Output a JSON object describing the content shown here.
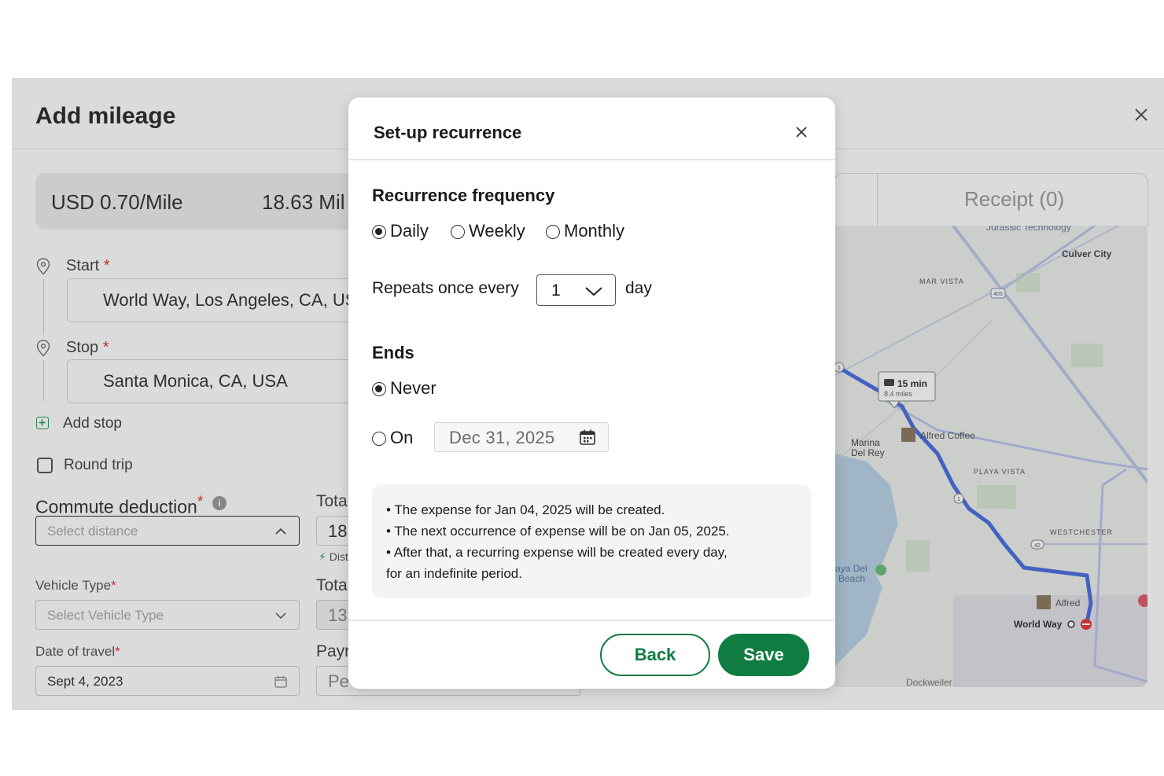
{
  "background": {
    "title": "Add mileage",
    "rate": "USD 0.70/Mile",
    "miles": "18.63 Mil",
    "tab_receipt": "Receipt (0)",
    "start_label": "Start",
    "start_value": "World Way, Los Angeles, CA, USA",
    "stop_label": "Stop",
    "stop_value": "Santa Monica, CA, USA",
    "required_mark": "*",
    "add_stop": "Add stop",
    "round_trip": "Round trip",
    "commute_label": "Commute deduction",
    "commute_placeholder": "Select distance",
    "vehicle_label": "Vehicle Type",
    "vehicle_placeholder": "Select Vehicle Type",
    "date_label": "Date of travel",
    "date_value": "Sept 4, 2023",
    "right_label_1": "Tota",
    "right_value_1": "18",
    "dist_note": "Dist",
    "right_label_2": "Tota",
    "right_value_2": "13",
    "right_label_3": "Payr",
    "right_value_3": "Pe"
  },
  "map": {
    "labels": {
      "jurassic": "Jurassic Technology",
      "culver": "Culver City",
      "mar_vista": "MAR VISTA",
      "marina1": "Marina",
      "marina2": "Del Rey",
      "alfred1": "Alfred Coffee",
      "playa": "PLAYA VISTA",
      "westchester": "WESTCHESTER",
      "playa_beach1": "aya Del",
      "playa_beach2": "Beach",
      "alfred2": "Alfred",
      "world_way": "World Way",
      "dockweiler": "Dockweiler",
      "route_time": "15 min",
      "route_dist": "8.4 miles",
      "shield_405": "405",
      "shield_1a": "1",
      "shield_1b": "1",
      "shield_42": "42"
    },
    "colors": {
      "route": "#4a6ee0",
      "road": "#b8c4e8",
      "water": "#aecbe0",
      "park": "#cfe3cf"
    }
  },
  "modal": {
    "title": "Set-up recurrence",
    "frequency_heading": "Recurrence frequency",
    "options": [
      "Daily",
      "Weekly",
      "Monthly"
    ],
    "selected_option": "Daily",
    "repeats_label": "Repeats once every",
    "repeats_value": "1",
    "repeats_unit": "day",
    "ends_heading": "Ends",
    "ends_never": "Never",
    "ends_on": "On",
    "ends_selected": "Never",
    "end_date": "Dec 31, 2025",
    "info_lines": [
      "• The expense for Jan 04, 2025 will be created.",
      "• The next occurrence of expense will be on Jan 05, 2025.",
      "• After that, a recurring expense will be created every day,",
      "for an indefinite period."
    ],
    "back_label": "Back",
    "save_label": "Save"
  },
  "colors": {
    "brand_green": "#107c41",
    "required_red": "#d33333"
  }
}
